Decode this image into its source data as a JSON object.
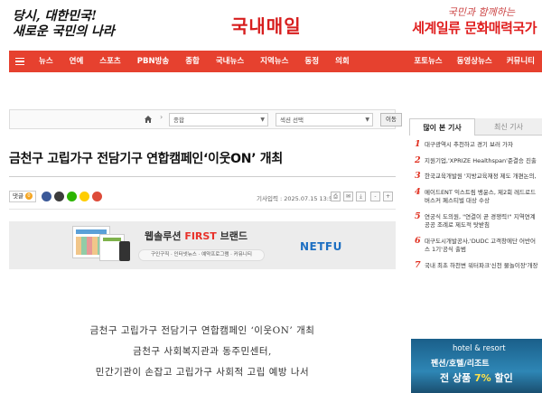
{
  "header": {
    "slogan_left_line1": "당시, 대한민국!",
    "slogan_left_line2": "새로운 국민의 나라",
    "logo": "국내매일",
    "slogan_right_small": "국민과 함께하는",
    "slogan_right_big": "세계일류 문화매력국가"
  },
  "nav": {
    "items": [
      "뉴스",
      "연예",
      "스포츠",
      "PBN방송",
      "종합",
      "국내뉴스",
      "지역뉴스",
      "동정",
      "의회"
    ],
    "right_items": [
      "포토뉴스",
      "동영상뉴스",
      "커뮤니티"
    ],
    "colors": {
      "bar": "#e6412f"
    }
  },
  "breadcrumb": {
    "select_section": "종합",
    "select_subsection": "섹션 선택",
    "go_button": "이동"
  },
  "article": {
    "title": "금천구 고립가구 전담기구 연합캠페인‘이웃ON’ 개최",
    "reply_label": "댓글",
    "reply_count": "0",
    "date": "기사입력 : 2025.07.15 13:58",
    "body": [
      "금천구 고립가구 전담기구 연합캠페인 ‘이웃ON’ 개최",
      "금천구 사회복지관과 동주민센터,",
      "민간기관이 손잡고 고립가구 사회적 고립 예방 나서"
    ]
  },
  "banner_ad": {
    "title_prefix": "웹솔루션 ",
    "title_highlight": "FIRST",
    "title_suffix": " 브랜드",
    "subtitle": "구인구직 · 인터넷뉴스 · 예약프로그램 · 커뮤니티",
    "logo": "NETFU"
  },
  "sidebar": {
    "tab_active": "많이 본 기사",
    "tab_inactive": "최신 기사",
    "items": [
      {
        "num": "1",
        "text": "대구광역시 추천하고 경기 보러 가자"
      },
      {
        "num": "2",
        "text": "지원기업,'XPRIZE Healthspan'준결승 진출"
      },
      {
        "num": "3",
        "text": "한국교육개발원 '지방교육재정 제도 개편논의,"
      },
      {
        "num": "4",
        "text": "메이드ENT 익스트림 뱅윤스, 제2회 레드로드 버스커 페스티벌 대상 수상"
      },
      {
        "num": "5",
        "text": "연궁식 도의원, \"연결이 곧 경쟁력!\" 지역연계공공 조례로 제도적 탓받침"
      },
      {
        "num": "6",
        "text": "대구도시개발공사,'DUDC 고객창에단 어반어스 1기'공식 출범"
      },
      {
        "num": "7",
        "text": "국내 최초 하천변 워터파크'신천 물놀이장'개장"
      }
    ],
    "hotel_ad": {
      "brand": "hotel & resort",
      "line1": "펜션/호텔/리조트",
      "line2_prefix": "전 상품 ",
      "line2_highlight": "7%",
      "line2_suffix": " 할인"
    }
  }
}
